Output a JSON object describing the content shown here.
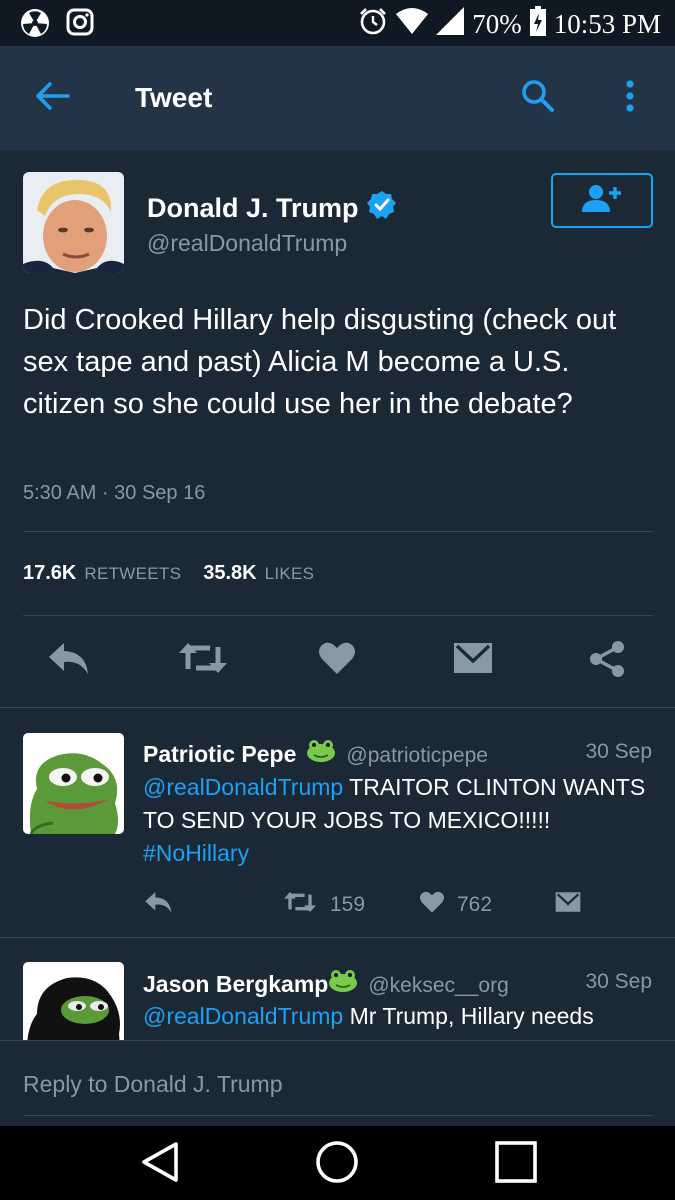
{
  "status_bar": {
    "battery": "70%",
    "time": "10:53 PM"
  },
  "app_bar": {
    "title": "Tweet"
  },
  "tweet": {
    "author_name": "Donald J. Trump",
    "author_handle": "@realDonaldTrump",
    "text": "Did Crooked Hillary help disgusting (check out sex tape and past) Alicia M become a U.S. citizen so she could use her in the debate?",
    "timestamp": "5:30 AM · 30 Sep 16",
    "retweets_count": "17.6K",
    "retweets_label": "RETWEETS",
    "likes_count": "35.8K",
    "likes_label": "LIKES"
  },
  "replies": [
    {
      "name": "Patriotic Pepe",
      "handle": "@patrioticpepe",
      "date": "30 Sep",
      "mention": "@realDonaldTrump",
      "text": " TRAITOR CLINTON WANTS TO SEND YOUR JOBS TO MEXICO!!!!!",
      "hashtag": "#NoHillary",
      "retweets": "159",
      "likes": "762"
    },
    {
      "name": "Jason Bergkamp",
      "handle": "@keksec__org",
      "date": "30 Sep",
      "mention": "@realDonaldTrump",
      "text": " Mr Trump, Hillary needs"
    }
  ],
  "composer": {
    "placeholder": "Reply to Donald J. Trump"
  },
  "colors": {
    "background": "#1b2836",
    "app_bar": "#243447",
    "accent": "#1da1f2",
    "secondary_text": "#8899a6"
  }
}
